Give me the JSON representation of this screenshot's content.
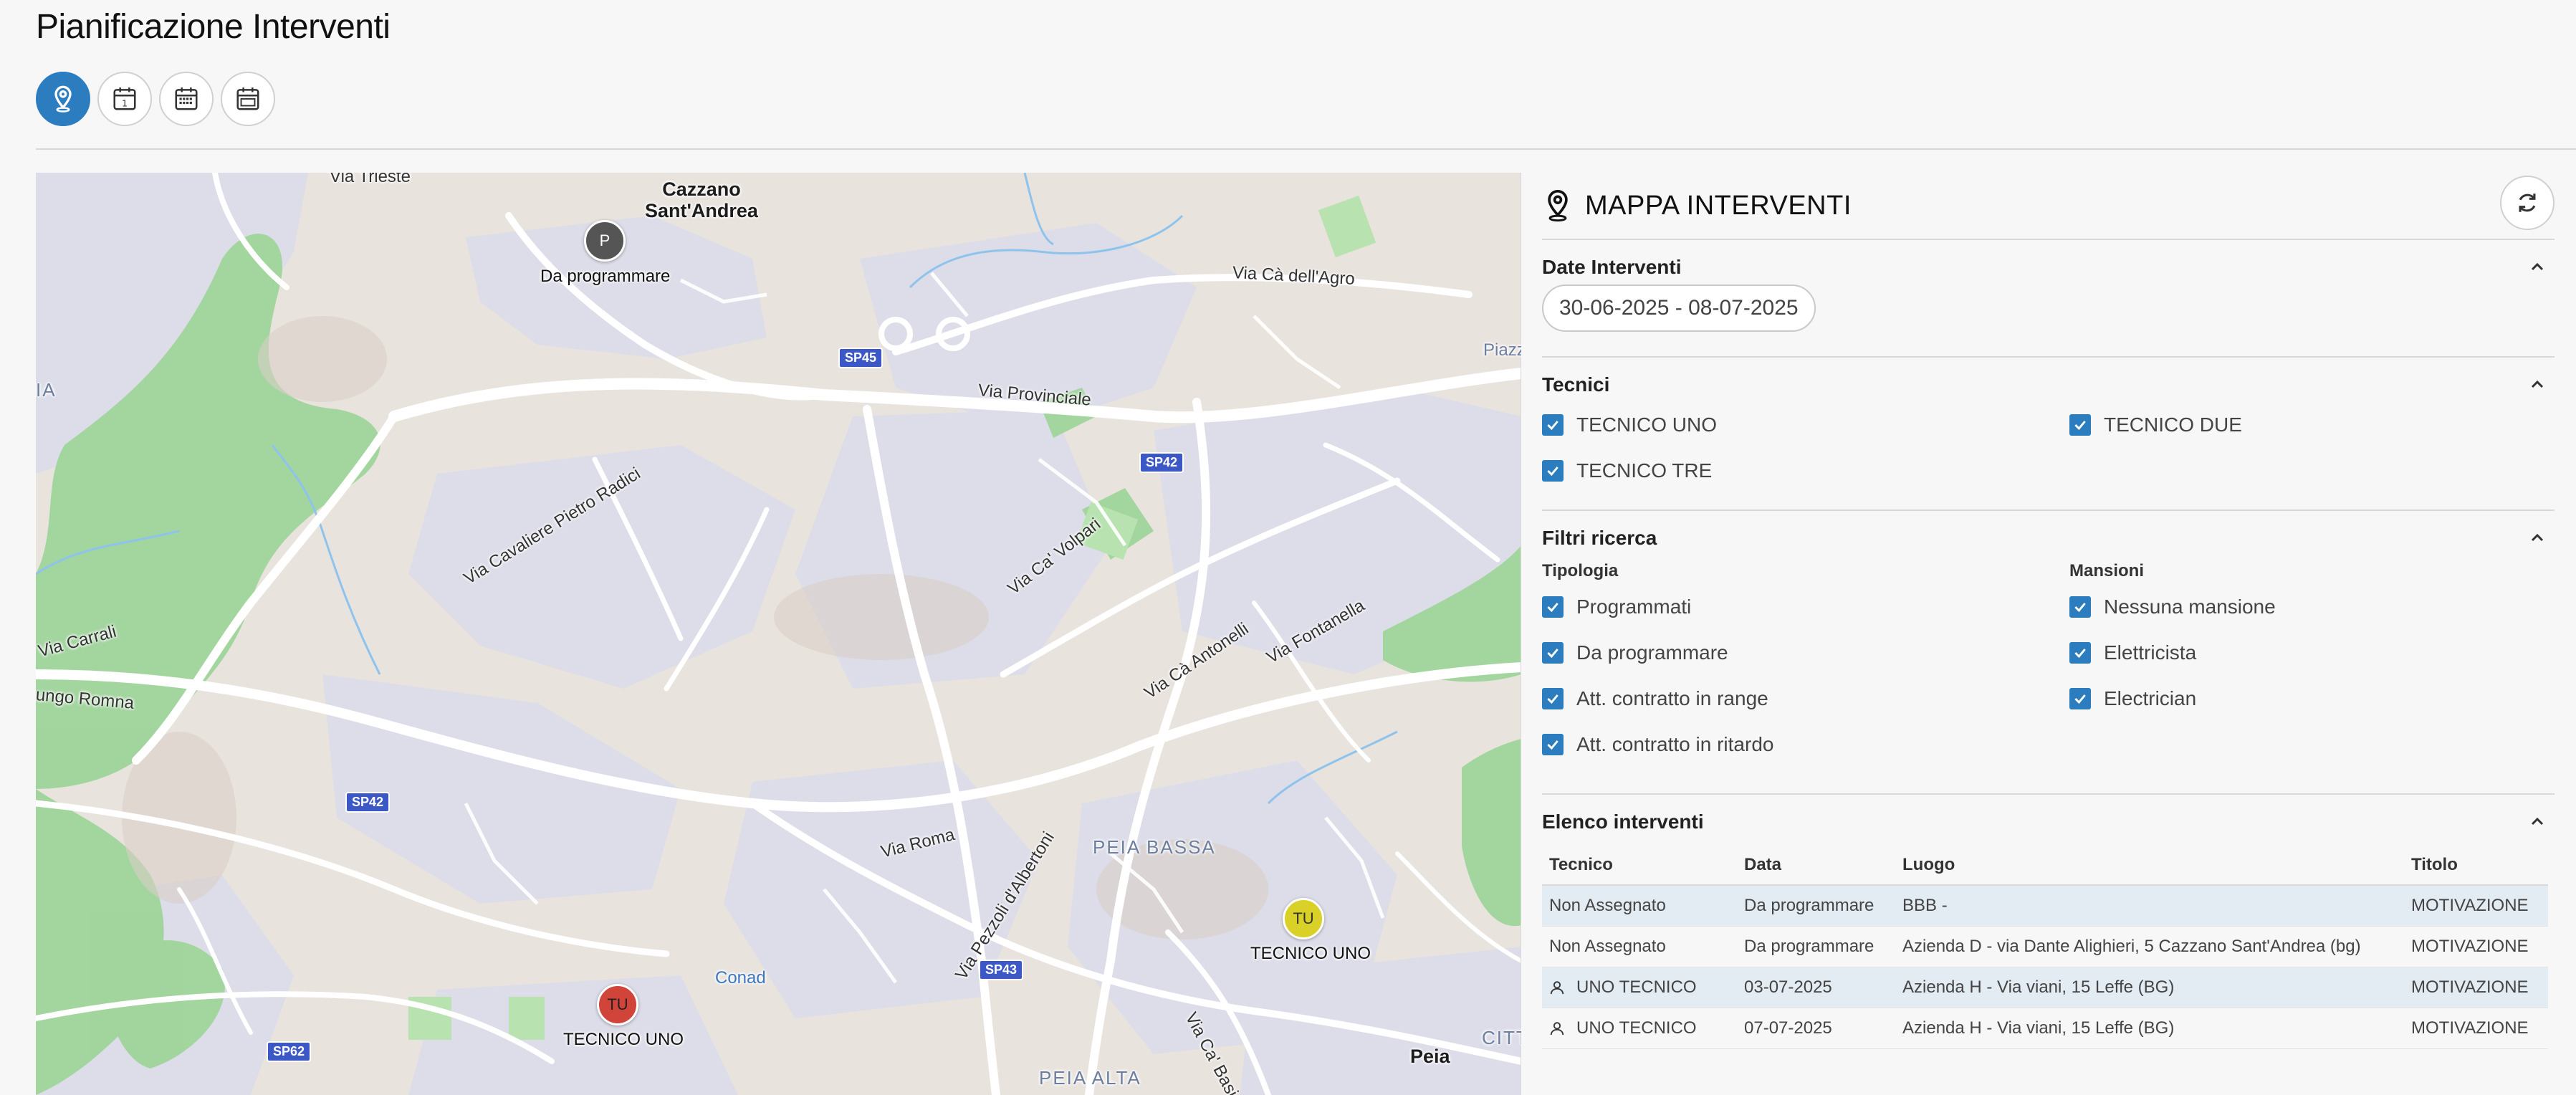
{
  "page": {
    "title": "Pianificazione Interventi"
  },
  "view_buttons": [
    {
      "icon": "map-pin-icon",
      "active": true
    },
    {
      "icon": "calendar-day-icon",
      "active": false
    },
    {
      "icon": "calendar-week-icon",
      "active": false
    },
    {
      "icon": "calendar-month-icon",
      "active": false
    }
  ],
  "map": {
    "labels": {
      "via_trieste": "Via Trieste",
      "cazzano": "Cazzano\nSant'Andrea",
      "via_ca_dell_agro": "Via Cà dell'Agro",
      "via_provinciale": "Via Provinciale",
      "via_cavaliere": "Via Cavaliere Pietro Radici",
      "via_ca_volpari": "Via Ca' Volpari",
      "via_ca_antonelli": "Via Cà Antonelli",
      "via_fontanella": "Via Fontanella",
      "via_carrali": "Via Carrali",
      "lungo_romna": "ungo Romna",
      "via_roma": "Via Roma",
      "via_pezzoli": "Via Pezzoli d'Albertoni",
      "peia_bassa": "PEIA BASSA",
      "peia_alta": "PEIA ALTA",
      "peia": "Peia",
      "via_ca_basi": "Via Ca' Basi",
      "conad": "Conad",
      "piazz": "Piazz",
      "citt": "CITT",
      "edge_a": "IA"
    },
    "shields": {
      "sp45": "SP45",
      "sp42a": "SP42",
      "sp42b": "SP42",
      "sp43": "SP43",
      "sp62": "SP62"
    },
    "markers": [
      {
        "initials": "P",
        "caption": "Da programmare",
        "color": "#555555"
      },
      {
        "initials": "TU",
        "caption": "TECNICO UNO",
        "color": "#d9d128"
      },
      {
        "initials": "TU",
        "caption": "TECNICO UNO",
        "color": "#d0443a"
      }
    ]
  },
  "panel": {
    "title": "MAPPA INTERVENTI",
    "date_section": {
      "title": "Date Interventi",
      "range": "30-06-2025 - 08-07-2025"
    },
    "tecnici_section": {
      "title": "Tecnici",
      "items": [
        "TECNICO UNO",
        "TECNICO DUE",
        "TECNICO TRE"
      ]
    },
    "filtri_section": {
      "title": "Filtri ricerca",
      "tipologia_label": "Tipologia",
      "tipologia": [
        "Programmati",
        "Da programmare",
        "Att. contratto in range",
        "Att. contratto in ritardo"
      ],
      "mansioni_label": "Mansioni",
      "mansioni": [
        "Nessuna mansione",
        "Elettricista",
        "Electrician"
      ]
    },
    "elenco_section": {
      "title": "Elenco interventi",
      "columns": [
        "Tecnico",
        "Data",
        "Luogo",
        "Titolo"
      ],
      "rows": [
        {
          "tecnico": "Non Assegnato",
          "data": "Da programmare",
          "luogo": "BBB -",
          "titolo": "MOTIVAZIONE"
        },
        {
          "tecnico": "Non Assegnato",
          "data": "Da programmare",
          "luogo": "Azienda D - via Dante Alighieri, 5 Cazzano Sant'Andrea (bg)",
          "titolo": "MOTIVAZIONE"
        },
        {
          "tecnico": "UNO TECNICO",
          "data": "03-07-2025",
          "luogo": "Azienda H - Via viani, 15 Leffe (BG)",
          "titolo": "MOTIVAZIONE"
        },
        {
          "tecnico": "UNO TECNICO",
          "data": "07-07-2025",
          "luogo": "Azienda H - Via viani, 15 Leffe (BG)",
          "titolo": "MOTIVAZIONE"
        }
      ]
    }
  },
  "colors": {
    "accent": "#2b7dc0",
    "row_shade": "#e3ebf3"
  }
}
